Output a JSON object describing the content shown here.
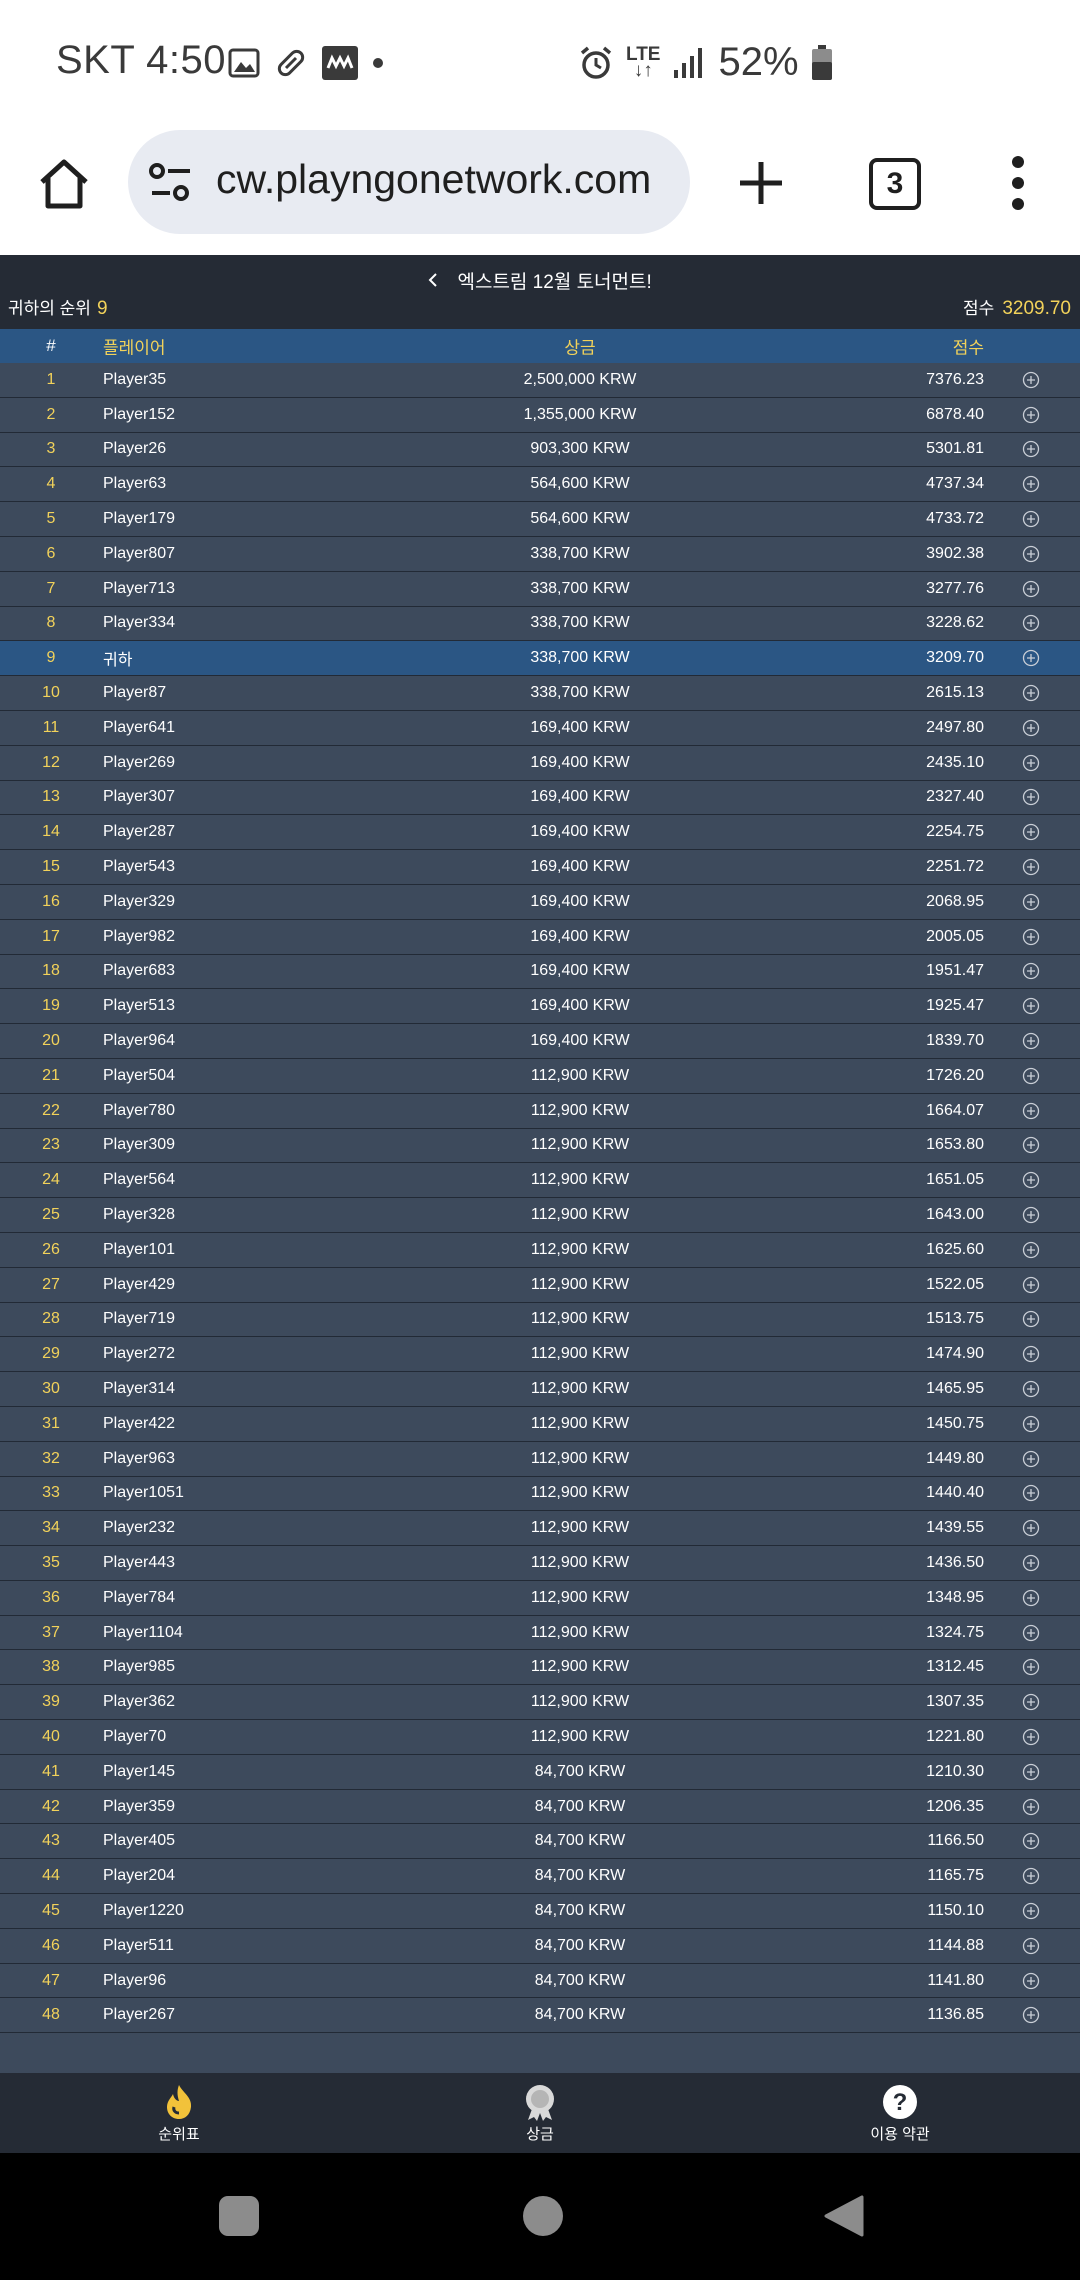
{
  "status_bar": {
    "carrier_time": "SKT 4:50",
    "network": "LTE",
    "battery": "52%"
  },
  "browser": {
    "url": "cw.playngonetwork.com",
    "tab_count": "3"
  },
  "tournament": {
    "title": "엑스트림 12월 토너먼트!",
    "my_rank_label": "귀하의 순위",
    "my_rank_value": "9",
    "my_score_label": "점수",
    "my_score_value": "3209.70"
  },
  "table": {
    "headers": {
      "rank": "#",
      "player": "플레이어",
      "prize": "상금",
      "score": "점수"
    },
    "highlight_rank": 9,
    "rows": [
      {
        "rank": "1",
        "player": "Player35",
        "prize": "2,500,000 KRW",
        "score": "7376.23"
      },
      {
        "rank": "2",
        "player": "Player152",
        "prize": "1,355,000 KRW",
        "score": "6878.40"
      },
      {
        "rank": "3",
        "player": "Player26",
        "prize": "903,300 KRW",
        "score": "5301.81"
      },
      {
        "rank": "4",
        "player": "Player63",
        "prize": "564,600 KRW",
        "score": "4737.34"
      },
      {
        "rank": "5",
        "player": "Player179",
        "prize": "564,600 KRW",
        "score": "4733.72"
      },
      {
        "rank": "6",
        "player": "Player807",
        "prize": "338,700 KRW",
        "score": "3902.38"
      },
      {
        "rank": "7",
        "player": "Player713",
        "prize": "338,700 KRW",
        "score": "3277.76"
      },
      {
        "rank": "8",
        "player": "Player334",
        "prize": "338,700 KRW",
        "score": "3228.62"
      },
      {
        "rank": "9",
        "player": "귀하",
        "prize": "338,700 KRW",
        "score": "3209.70"
      },
      {
        "rank": "10",
        "player": "Player87",
        "prize": "338,700 KRW",
        "score": "2615.13"
      },
      {
        "rank": "11",
        "player": "Player641",
        "prize": "169,400 KRW",
        "score": "2497.80"
      },
      {
        "rank": "12",
        "player": "Player269",
        "prize": "169,400 KRW",
        "score": "2435.10"
      },
      {
        "rank": "13",
        "player": "Player307",
        "prize": "169,400 KRW",
        "score": "2327.40"
      },
      {
        "rank": "14",
        "player": "Player287",
        "prize": "169,400 KRW",
        "score": "2254.75"
      },
      {
        "rank": "15",
        "player": "Player543",
        "prize": "169,400 KRW",
        "score": "2251.72"
      },
      {
        "rank": "16",
        "player": "Player329",
        "prize": "169,400 KRW",
        "score": "2068.95"
      },
      {
        "rank": "17",
        "player": "Player982",
        "prize": "169,400 KRW",
        "score": "2005.05"
      },
      {
        "rank": "18",
        "player": "Player683",
        "prize": "169,400 KRW",
        "score": "1951.47"
      },
      {
        "rank": "19",
        "player": "Player513",
        "prize": "169,400 KRW",
        "score": "1925.47"
      },
      {
        "rank": "20",
        "player": "Player964",
        "prize": "169,400 KRW",
        "score": "1839.70"
      },
      {
        "rank": "21",
        "player": "Player504",
        "prize": "112,900 KRW",
        "score": "1726.20"
      },
      {
        "rank": "22",
        "player": "Player780",
        "prize": "112,900 KRW",
        "score": "1664.07"
      },
      {
        "rank": "23",
        "player": "Player309",
        "prize": "112,900 KRW",
        "score": "1653.80"
      },
      {
        "rank": "24",
        "player": "Player564",
        "prize": "112,900 KRW",
        "score": "1651.05"
      },
      {
        "rank": "25",
        "player": "Player328",
        "prize": "112,900 KRW",
        "score": "1643.00"
      },
      {
        "rank": "26",
        "player": "Player101",
        "prize": "112,900 KRW",
        "score": "1625.60"
      },
      {
        "rank": "27",
        "player": "Player429",
        "prize": "112,900 KRW",
        "score": "1522.05"
      },
      {
        "rank": "28",
        "player": "Player719",
        "prize": "112,900 KRW",
        "score": "1513.75"
      },
      {
        "rank": "29",
        "player": "Player272",
        "prize": "112,900 KRW",
        "score": "1474.90"
      },
      {
        "rank": "30",
        "player": "Player314",
        "prize": "112,900 KRW",
        "score": "1465.95"
      },
      {
        "rank": "31",
        "player": "Player422",
        "prize": "112,900 KRW",
        "score": "1450.75"
      },
      {
        "rank": "32",
        "player": "Player963",
        "prize": "112,900 KRW",
        "score": "1449.80"
      },
      {
        "rank": "33",
        "player": "Player1051",
        "prize": "112,900 KRW",
        "score": "1440.40"
      },
      {
        "rank": "34",
        "player": "Player232",
        "prize": "112,900 KRW",
        "score": "1439.55"
      },
      {
        "rank": "35",
        "player": "Player443",
        "prize": "112,900 KRW",
        "score": "1436.50"
      },
      {
        "rank": "36",
        "player": "Player784",
        "prize": "112,900 KRW",
        "score": "1348.95"
      },
      {
        "rank": "37",
        "player": "Player1104",
        "prize": "112,900 KRW",
        "score": "1324.75"
      },
      {
        "rank": "38",
        "player": "Player985",
        "prize": "112,900 KRW",
        "score": "1312.45"
      },
      {
        "rank": "39",
        "player": "Player362",
        "prize": "112,900 KRW",
        "score": "1307.35"
      },
      {
        "rank": "40",
        "player": "Player70",
        "prize": "112,900 KRW",
        "score": "1221.80"
      },
      {
        "rank": "41",
        "player": "Player145",
        "prize": "84,700 KRW",
        "score": "1210.30"
      },
      {
        "rank": "42",
        "player": "Player359",
        "prize": "84,700 KRW",
        "score": "1206.35"
      },
      {
        "rank": "43",
        "player": "Player405",
        "prize": "84,700 KRW",
        "score": "1166.50"
      },
      {
        "rank": "44",
        "player": "Player204",
        "prize": "84,700 KRW",
        "score": "1165.75"
      },
      {
        "rank": "45",
        "player": "Player1220",
        "prize": "84,700 KRW",
        "score": "1150.10"
      },
      {
        "rank": "46",
        "player": "Player511",
        "prize": "84,700 KRW",
        "score": "1144.88"
      },
      {
        "rank": "47",
        "player": "Player96",
        "prize": "84,700 KRW",
        "score": "1141.80"
      },
      {
        "rank": "48",
        "player": "Player267",
        "prize": "84,700 KRW",
        "score": "1136.85"
      }
    ]
  },
  "app_nav": [
    {
      "label": "순위표",
      "icon": "flame-icon"
    },
    {
      "label": "상금",
      "icon": "medal-icon"
    },
    {
      "label": "이용 약관",
      "icon": "help-icon"
    }
  ]
}
